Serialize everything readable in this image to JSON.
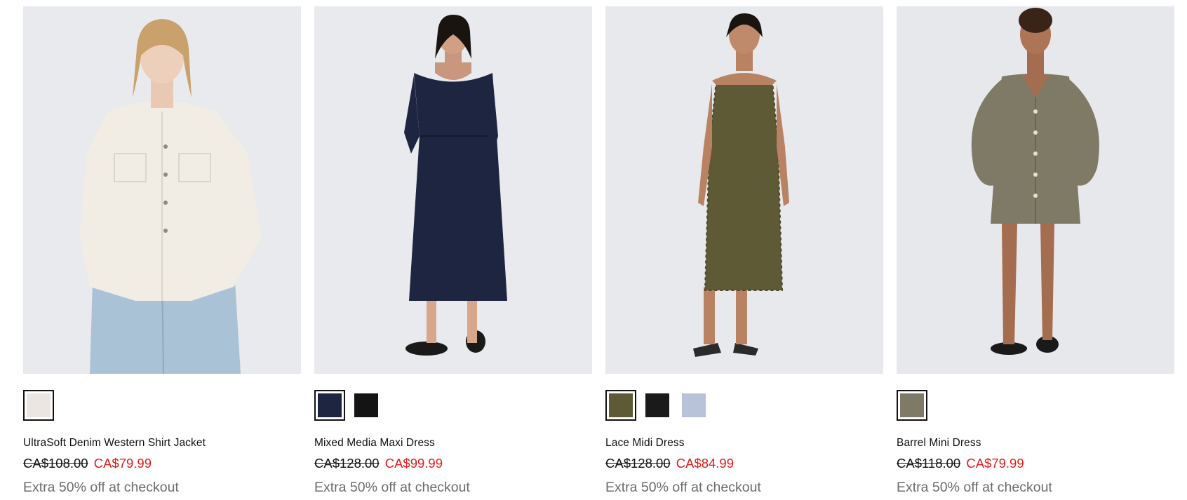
{
  "products": [
    {
      "name": "UltraSoft Denim Western Shirt Jacket",
      "price_original": "CA$108.00",
      "price_sale": "CA$79.99",
      "promo": "Extra 50% off at checkout",
      "swatches": [
        {
          "color": "#ebe6e2",
          "selected": true
        }
      ]
    },
    {
      "name": "Mixed Media Maxi Dress",
      "price_original": "CA$128.00",
      "price_sale": "CA$99.99",
      "promo": "Extra 50% off at checkout",
      "swatches": [
        {
          "color": "#1e2540",
          "selected": true
        },
        {
          "color": "#141414",
          "selected": false
        }
      ]
    },
    {
      "name": "Lace Midi Dress",
      "price_original": "CA$128.00",
      "price_sale": "CA$84.99",
      "promo": "Extra 50% off at checkout",
      "swatches": [
        {
          "color": "#5e5a35",
          "selected": true
        },
        {
          "color": "#1a1a1a",
          "selected": false
        },
        {
          "color": "#b8c3da",
          "selected": false
        }
      ]
    },
    {
      "name": "Barrel Mini Dress",
      "price_original": "CA$118.00",
      "price_sale": "CA$79.99",
      "promo": "Extra 50% off at checkout",
      "swatches": [
        {
          "color": "#7e7a66",
          "selected": true
        }
      ]
    }
  ]
}
